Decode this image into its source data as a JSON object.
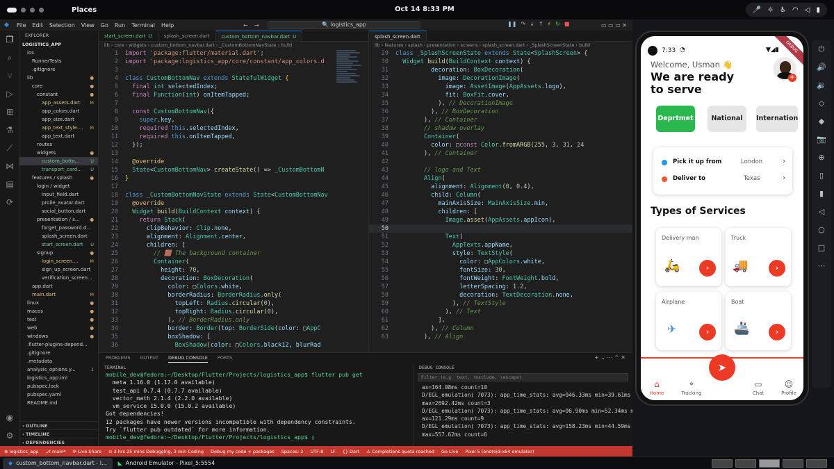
{
  "system": {
    "places": "Places",
    "clock": "Oct 14   8:33 PM"
  },
  "ide": {
    "menu": [
      "File",
      "Edit",
      "Selection",
      "View",
      "Go",
      "Run",
      "Terminal",
      "Help"
    ],
    "search": "logistics_app",
    "explorer_title": "EXPLORER",
    "project": "LOGISTICS_APP",
    "tree": [
      {
        "label": "ios",
        "indent": 1,
        "st": ""
      },
      {
        "label": "RunnerTests",
        "indent": 2,
        "st": ""
      },
      {
        "label": ".gitignore",
        "indent": 2,
        "st": ""
      },
      {
        "label": "lib",
        "indent": 1,
        "st": "●"
      },
      {
        "label": "core",
        "indent": 2,
        "st": "●"
      },
      {
        "label": "constant",
        "indent": 3,
        "st": "●"
      },
      {
        "label": "app_assets.dart",
        "indent": 4,
        "st": "M"
      },
      {
        "label": "app_colors.dart",
        "indent": 4,
        "st": ""
      },
      {
        "label": "app_size.dart",
        "indent": 4,
        "st": ""
      },
      {
        "label": "app_text_style....",
        "indent": 4,
        "st": "M"
      },
      {
        "label": "app_text.dart",
        "indent": 4,
        "st": ""
      },
      {
        "label": "routes",
        "indent": 3,
        "st": ""
      },
      {
        "label": "widgets",
        "indent": 3,
        "st": "●"
      },
      {
        "label": "custom_botto...",
        "indent": 4,
        "st": "U"
      },
      {
        "label": "transport_card...",
        "indent": 4,
        "st": "U"
      },
      {
        "label": "features / splash",
        "indent": 2,
        "st": "●"
      },
      {
        "label": "login / widget",
        "indent": 3,
        "st": ""
      },
      {
        "label": "input_field.dart",
        "indent": 4,
        "st": ""
      },
      {
        "label": "proile_avatar.dart",
        "indent": 4,
        "st": ""
      },
      {
        "label": "social_button.dart",
        "indent": 4,
        "st": ""
      },
      {
        "label": "presentation / s...",
        "indent": 3,
        "st": "●"
      },
      {
        "label": "forget_password.d...",
        "indent": 4,
        "st": ""
      },
      {
        "label": "splash_screen.dart",
        "indent": 4,
        "st": ""
      },
      {
        "label": "start_screen.dart",
        "indent": 4,
        "st": "U"
      },
      {
        "label": "signup",
        "indent": 3,
        "st": "●"
      },
      {
        "label": "login_screen....",
        "indent": 4,
        "st": "M"
      },
      {
        "label": "sign_up_screen.dart",
        "indent": 4,
        "st": ""
      },
      {
        "label": "verification_screen...",
        "indent": 4,
        "st": ""
      },
      {
        "label": "app.dart",
        "indent": 2,
        "st": ""
      },
      {
        "label": "main.dart",
        "indent": 2,
        "st": "M"
      },
      {
        "label": "linux",
        "indent": 1,
        "st": "●"
      },
      {
        "label": "macos",
        "indent": 1,
        "st": "●"
      },
      {
        "label": "test",
        "indent": 1,
        "st": "●"
      },
      {
        "label": "web",
        "indent": 1,
        "st": "●"
      },
      {
        "label": "windows",
        "indent": 1,
        "st": "●"
      },
      {
        "label": ".flutter-plugins-depend...",
        "indent": 1,
        "st": ""
      },
      {
        "label": ".gitignore",
        "indent": 1,
        "st": ""
      },
      {
        "label": ".metadata",
        "indent": 1,
        "st": ""
      },
      {
        "label": "analysis_options.y...",
        "indent": 1,
        "st": "1"
      },
      {
        "label": "logistics_app.iml",
        "indent": 1,
        "st": ""
      },
      {
        "label": "pubspec.lock",
        "indent": 1,
        "st": ""
      },
      {
        "label": "pubspec.yaml",
        "indent": 1,
        "st": ""
      },
      {
        "label": "README.md",
        "indent": 1,
        "st": ""
      }
    ],
    "explorer_bottom": [
      "OUTLINE",
      "TIMELINE",
      "DEPENDENCIES"
    ],
    "left_tabs": [
      {
        "label": "start_screen.dart",
        "u": "U"
      },
      {
        "label": "splash_screen.dart",
        "u": ""
      },
      {
        "label": "custom_bottom_navbar.dart",
        "u": "U"
      }
    ],
    "right_tabs": [
      {
        "label": "splash_screen.dart",
        "u": ""
      }
    ],
    "left_crumb": "lib › core › widgets › custom_bottom_navbar.dart › _CustomBottomNavState › build",
    "right_crumb": "lib › features › splash › presentation › screens › splash_screen.dart › _SplashScreenState › build",
    "panel_tabs": [
      "PROBLEMS",
      "OUTPUT",
      "DEBUG CONSOLE",
      "PORTS"
    ],
    "terminal_title": "TERMINAL",
    "terminal_lines": [
      "mobile_dev@fedora:~/Desktop/Flutter/Projects/logistics_app$ flutter pub get",
      "  meta 1.16.0 (1.17.0 available)",
      "  test_api 0.7.4 (0.7.7 available)",
      "  vector_math 2.1.4 (2.2.0 available)",
      "  vm_service 15.0.0 (15.0.2 available)",
      "Got dependencies!",
      "12 packages have newer versions incompatible with dependency constraints.",
      "Try `flutter pub outdated` for more information.",
      "mobile_dev@fedora:~/Desktop/Flutter/Projects/logistics_app$ ▯"
    ],
    "debug_title": "DEBUG CONSOLE",
    "debug_filter": "Filter (e.g. text, !exclude, \\escape)",
    "debug_lines": [
      "ax=164.08ms count=10",
      "D/EGL_emulation( 7073): app_time_stats: avg=946.33ms min=39.61ms",
      "max=2692.42ms count=3",
      "D/EGL_emulation( 7073): app_time_stats: avg=96.90ms min=52.34ms m",
      "ax=121.29ms count=9",
      "D/EGL_emulation( 7073): app_time_stats: avg=158.23ms min=44.59ms",
      "max=557.62ms count=6"
    ],
    "status": [
      "⊗ logistics_app",
      "⎇ main*",
      "⟳ Live Share",
      "⊙ 3 hrs 25 mins Debugging, 3 min Coding",
      "Debug my code + packages",
      "Spaces: 2",
      "UTF-8",
      "LF",
      "{} Dart",
      "⚠ Completions quota reached",
      "Go Live",
      "Pixel 5 (android-x64 emulator)"
    ]
  },
  "taskbar": [
    {
      "label": "custom_bottom_navbar.dart - l..."
    },
    {
      "label": "Android Emulator - Pixel_5:5554"
    }
  ],
  "app": {
    "time": "7:33",
    "debug": "DEBUG",
    "welcome": "Welcome, Usman 👋",
    "headline1": "We are ready",
    "headline2": "to serve",
    "categories": [
      "Deprtmet",
      "National",
      "Internation"
    ],
    "pickup_label": "Pick it up from",
    "pickup_value": "London",
    "deliver_label": "Deliver to",
    "deliver_value": "Texas",
    "services_title": "Types of Services",
    "services": [
      {
        "name": "Delivery man",
        "icon": "🛵"
      },
      {
        "name": "Truck",
        "icon": "🚚"
      },
      {
        "name": "Airplane",
        "icon": "✈"
      },
      {
        "name": "Boat",
        "icon": "🚢"
      }
    ],
    "nav": [
      "Home",
      "Tracking",
      "",
      "Chat",
      "Profile"
    ],
    "colors": {
      "green": "#2bb84e",
      "red": "#ee3a24",
      "blue": "#2196f3",
      "orange": "#f05a28"
    }
  }
}
